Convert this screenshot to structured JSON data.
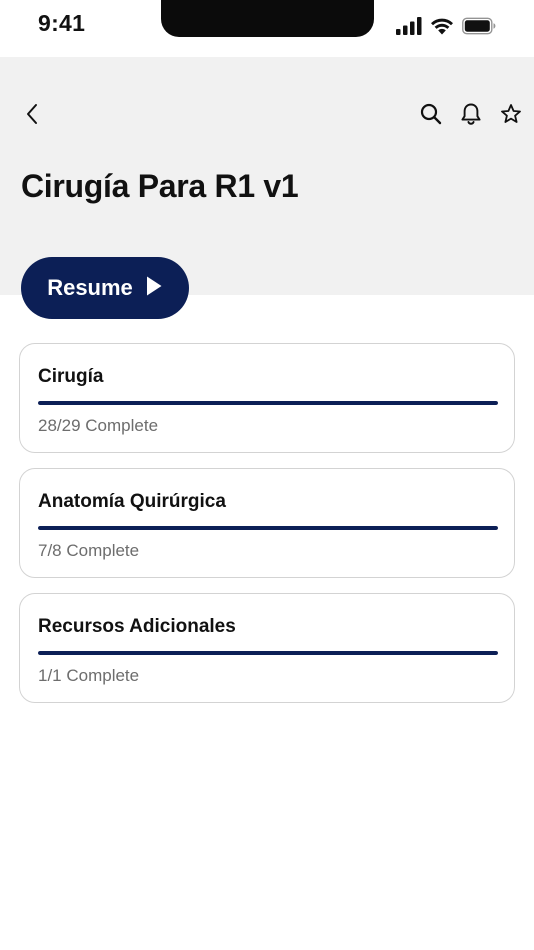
{
  "status_bar": {
    "time": "9:41"
  },
  "header": {
    "title": "Cirugía Para R1 v1",
    "icons": [
      "chevron-left-icon",
      "search-icon",
      "bell-icon",
      "star-icon"
    ]
  },
  "resume": {
    "label": "Resume",
    "icon": "play-icon"
  },
  "colors": {
    "accent": "#0c1f56",
    "header_bg": "#f1f1f1",
    "card_border": "#d3d3d3",
    "muted_text": "#6d6d6d"
  },
  "sections": [
    {
      "title": "Cirugía",
      "status": "28/29 Complete",
      "progress": 1.0
    },
    {
      "title": "Anatomía Quirúrgica",
      "status": "7/8 Complete",
      "progress": 1.0
    },
    {
      "title": "Recursos Adicionales",
      "status": "1/1 Complete",
      "progress": 1.0
    }
  ]
}
